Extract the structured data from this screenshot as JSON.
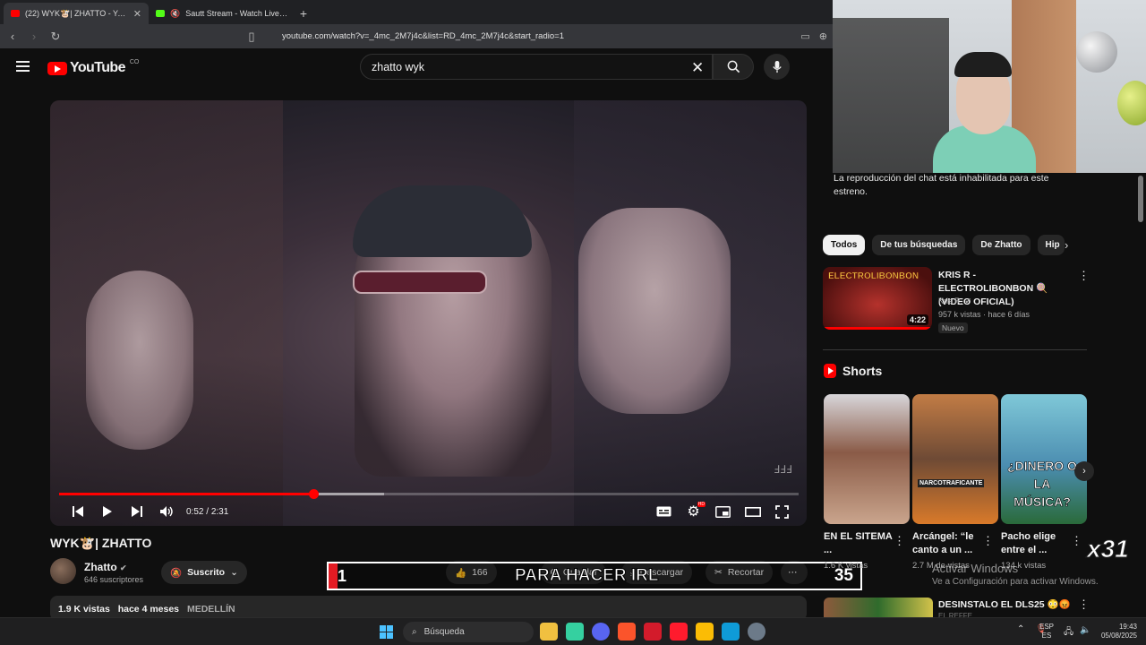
{
  "browser": {
    "tabs": [
      {
        "title": "(22) WYK🐮| ZHATTO - YouTube",
        "active": true,
        "favicon_color": "#ff0000"
      },
      {
        "title": "Sautt Stream - Watch Live on Kick",
        "active": false,
        "favicon_color": "#53fc18"
      }
    ],
    "url": "youtube.com/watch?v=_4mc_2M7j4c&list=RD_4mc_2M7j4c&start_radio=1"
  },
  "youtube": {
    "logo_text": "YouTube",
    "country_code": "CO",
    "search_query": "zhatto wyk"
  },
  "player": {
    "time_current": "0:52",
    "time_total": "2:31",
    "played_fraction": 0.344,
    "buffered_fraction": 0.44,
    "watermark": "ℲℲℲ"
  },
  "video": {
    "title": "WYK🐮| ZHATTO",
    "channel": "Zhatto",
    "subscribers": "646 suscriptores",
    "subscribe_label": "Suscrito",
    "like_count": "166",
    "action_save": "Guardar",
    "action_download": "Descargar",
    "action_clip": "Recortar",
    "views": "1.9 K vistas",
    "published": "hace 4 meses",
    "location": "MEDELLÍN"
  },
  "stream_overlay": {
    "left_number": "1",
    "caption": "PARA HACER IRL",
    "right_number": "35",
    "multiplier": "x31"
  },
  "sidebar": {
    "chat_disabled": "La reproducción del chat está inhabilitada para este estreno.",
    "chips": [
      "Todos",
      "De tus búsquedas",
      "De Zhatto",
      "Hip"
    ],
    "recommendation": {
      "thumb_text": "ELECTROLIBONBON",
      "duration": "4:22",
      "title": "KRIS R - ELECTROLIBONBON 🍭 (VIDEO OFICIAL)",
      "channel": "Kris R.",
      "meta": "957 k vistas · hace 6 días",
      "badge": "Nuevo"
    },
    "shorts_heading": "Shorts",
    "shorts": [
      {
        "title": "EN EL SITEMA ...",
        "views": "1.6 K vistas",
        "thumb_text": ""
      },
      {
        "title": "Arcángel: “le canto a un ...",
        "views": "2.7 M de vistas",
        "thumb_text": "NARCOTRAFICANTE"
      },
      {
        "title": "Pacho elige entre el ...",
        "views": "134 k vistas",
        "thumb_text": "¿DINERO O LA MÚSICA?"
      }
    ],
    "next_video": {
      "title": "DESINSTALO EL DLS25 😳😡",
      "channel": "EL REFFE"
    }
  },
  "windows_activation": {
    "line1": "Activar Windows",
    "line2": "Ve a Configuración para activar Windows."
  },
  "taskbar": {
    "search_placeholder": "Búsqueda",
    "lang_top": "ESP",
    "lang_bottom": "ES",
    "time": "19:43",
    "date": "05/08/2025",
    "icon_colors": [
      "#f0c040",
      "#35d0a0",
      "#5865f2",
      "#fb542b",
      "#d31b2b",
      "#ff1b2d",
      "#fbbc05",
      "#0f9bd7",
      "#6c7a89"
    ]
  }
}
